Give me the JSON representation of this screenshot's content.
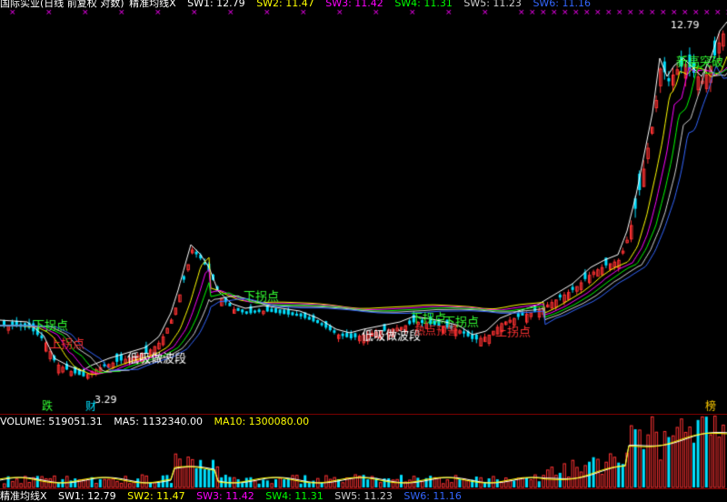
{
  "header": {
    "title": "国际实业(日线 前复权 对数)",
    "indicator": "精准均线X",
    "sw": [
      {
        "label": "SW1: 12.79",
        "color": "#ffffff"
      },
      {
        "label": "SW2: 11.47",
        "color": "#ffff00"
      },
      {
        "label": "SW3: 11.42",
        "color": "#ff00ff"
      },
      {
        "label": "SW4: 11.31",
        "color": "#00ff00"
      },
      {
        "label": "SW5: 11.23",
        "color": "#d0d0d0"
      },
      {
        "label": "SW6: 11.16",
        "color": "#3366ff"
      }
    ]
  },
  "volume_header": {
    "volume": "VOLUME: 519051.31",
    "ma5": "MA5: 1132340.00",
    "ma10": "MA10: 1300080.00"
  },
  "bottom_header": {
    "name": "精准均线X",
    "sw1": "SW1: 12.79",
    "sw2": "SW2: 11.47",
    "sw3": "SW3: 11.42",
    "sw4": "SW4: 11.31",
    "sw5": "SW5: 11.23",
    "sw6": "SW6: 11.16"
  },
  "annotations": {
    "high_price": "12.79",
    "low_price": "3.29",
    "low_label": "跌",
    "low_label2": "财",
    "right_label": "榜",
    "down_turn": "下拐点",
    "up_turn": "上拐点",
    "low_buy": "低吸做波段",
    "hot_warn": "热点预警",
    "new_high": "新高突破"
  },
  "colors": {
    "up": "#ff3232",
    "down": "#00e0ff",
    "sw_green": "#00ff00",
    "label_green": "#33ff33",
    "label_red": "#ff3232",
    "marker": "#ff00ff"
  }
}
